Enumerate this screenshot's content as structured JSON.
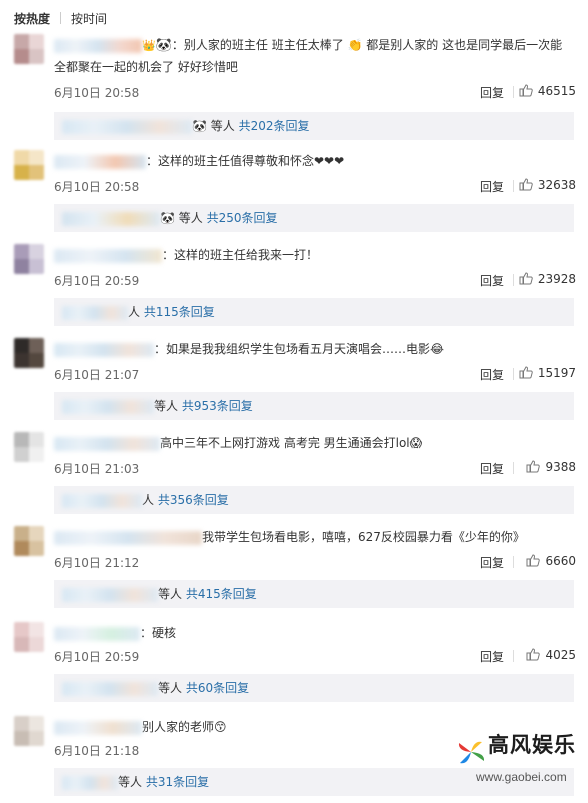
{
  "tabs": [
    "按热度",
    "按时间"
  ],
  "comments": [
    {
      "text": "别人家的班主任  班主任太棒了 👏 都是别人家的 这也是同学最后一次能",
      "text2": "全都聚在一起的机会了 好好珍惜吧",
      "time": "6月10日 20:58",
      "reply": "回复",
      "likes": "46515",
      "sub": "🐼 等人 共202条回复"
    },
    {
      "text": "：这样的班主任值得尊敬和怀念❤❤❤",
      "time": "6月10日 20:58",
      "reply": "回复",
      "likes": "32638",
      "sub": "🐼 等人 共250条回复"
    },
    {
      "text": "：这样的班主任给我来一打！",
      "time": "6月10日 20:59",
      "reply": "回复",
      "likes": "23928",
      "sub": "人 共115条回复"
    },
    {
      "text": "：如果是我我组织学生包场看五月天演唱会……电影😂",
      "time": "6月10日 21:07",
      "reply": "回复",
      "likes": "15197",
      "sub": "等人 共953条回复"
    },
    {
      "text": "高中三年不上网打游戏 高考完 男生通通会打lol😱",
      "time": "6月10日 21:03",
      "reply": "回复",
      "likes": "9388",
      "sub": "人 共356条回复"
    },
    {
      "text": "我带学生包场看电影，嘻嘻，627反校园暴力看《少年的你》",
      "time": "6月10日 21:12",
      "reply": "回复",
      "likes": "6660",
      "sub": "等人 共415条回复"
    },
    {
      "text": "：硬核",
      "time": "6月10日 20:59",
      "reply": "回复",
      "likes": "4025",
      "sub": "等人 共60条回复"
    },
    {
      "text": "别人家的老师😙",
      "time": "6月10日 21:18",
      "reply": "回复",
      "likes": "",
      "sub": "等人 共31条回复"
    }
  ],
  "watermark": {
    "name": "高风娱乐",
    "url": "www.gaobei.com"
  },
  "colors": {
    "link": "#2a6fa8",
    "sub_bg": "#f2f2f5"
  }
}
